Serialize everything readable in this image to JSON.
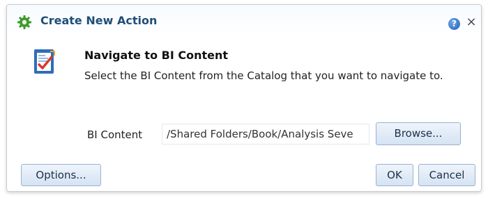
{
  "dialog": {
    "title": "Create New Action",
    "help_icon": "help-icon",
    "close_symbol": "×",
    "heading": "Navigate to BI Content",
    "description": "Select the BI Content from the Catalog that you want to navigate to.",
    "field": {
      "label": "BI Content",
      "value": "/Shared Folders/Book/Analysis Seve"
    },
    "buttons": {
      "browse": "Browse...",
      "options": "Options...",
      "ok": "OK",
      "cancel": "Cancel"
    }
  },
  "icons": {
    "title": "gear-icon",
    "content": "report-checkmark-icon"
  },
  "colors": {
    "title_text": "#1f4e79",
    "button_border": "#99b2cf",
    "button_fill_top": "#eef4fb",
    "button_fill_bottom": "#d5e3f3"
  }
}
